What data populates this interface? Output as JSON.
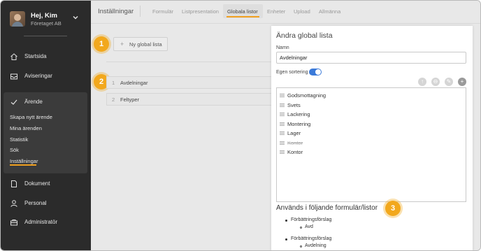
{
  "user": {
    "greeting": "Hej, Kim",
    "company": "Företaget AB"
  },
  "sidebar": {
    "items": [
      {
        "label": "Startsida",
        "icon": "home-icon"
      },
      {
        "label": "Aviseringar",
        "icon": "inbox-icon"
      },
      {
        "label": "Ärende",
        "icon": "check-icon"
      },
      {
        "label": "Dokument",
        "icon": "document-icon"
      },
      {
        "label": "Personal",
        "icon": "person-icon"
      },
      {
        "label": "Administratör",
        "icon": "briefcase-icon"
      }
    ],
    "arende_sub": [
      "Skapa nytt ärende",
      "Mina ärenden",
      "Statistik",
      "Sök",
      "Inställningar"
    ],
    "active_sub": "Inställningar"
  },
  "header": {
    "title": "Inställningar",
    "tabs": [
      "Formulär",
      "Listpresentation",
      "Globala listor",
      "Enheter",
      "Upload",
      "Allmänna"
    ],
    "active_tab": "Globala listor"
  },
  "main": {
    "new_list_label": "Ny global lista",
    "lists": [
      {
        "num": "1",
        "name": "Avdelningar"
      },
      {
        "num": "2",
        "name": "Feltyper"
      }
    ]
  },
  "badges": [
    "1",
    "2",
    "3"
  ],
  "panel": {
    "title": "Ändra global lista",
    "name_label": "Namn",
    "name_value": "Avdelningar",
    "sort_label": "Egen sortering",
    "sort_enabled": true,
    "items": [
      {
        "text": "Godsmottagning",
        "struck": false
      },
      {
        "text": "Svets",
        "struck": false
      },
      {
        "text": "Lackering",
        "struck": false
      },
      {
        "text": "Montering",
        "struck": false
      },
      {
        "text": "Lager",
        "struck": false
      },
      {
        "text": "Kontor",
        "struck": true
      },
      {
        "text": "Kontor",
        "struck": false
      }
    ],
    "used_title": "Används i följande formulär/listor",
    "used": [
      {
        "form": "Förbättringsförslag",
        "list": "Avd"
      },
      {
        "form": "Förbättringsförslag",
        "list": "Avdelning"
      }
    ]
  },
  "colors": {
    "accent": "#f2a81d",
    "sidebar_bg": "#2b2b2b",
    "toggle": "#3b7ad9"
  }
}
